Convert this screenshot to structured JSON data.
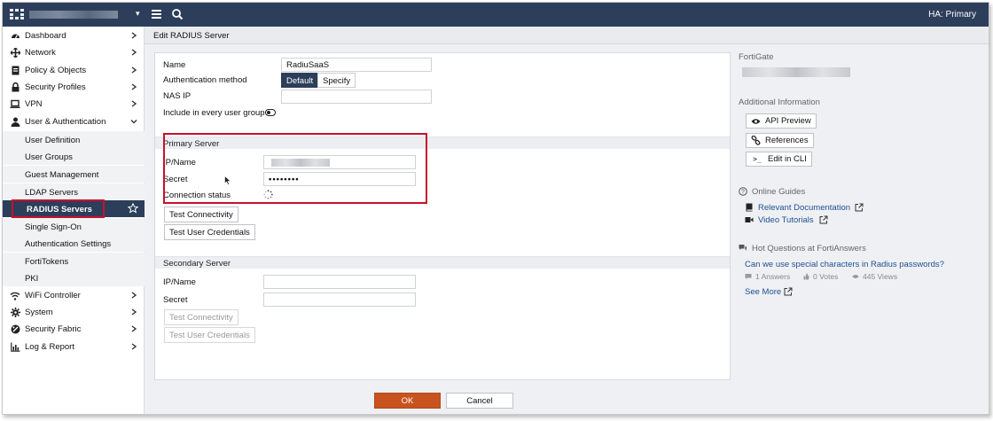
{
  "topbar": {
    "ha_status": "HA: Primary"
  },
  "sidebar": {
    "items": [
      {
        "label": "Dashboard",
        "icon": "dashboard-icon"
      },
      {
        "label": "Network",
        "icon": "network-icon"
      },
      {
        "label": "Policy & Objects",
        "icon": "policy-icon"
      },
      {
        "label": "Security Profiles",
        "icon": "lock-icon"
      },
      {
        "label": "VPN",
        "icon": "laptop-icon"
      },
      {
        "label": "User & Authentication",
        "icon": "user-icon"
      }
    ],
    "sub_items": [
      {
        "label": "User Definition"
      },
      {
        "label": "User Groups"
      },
      {
        "label": "Guest Management"
      },
      {
        "label": "LDAP Servers"
      },
      {
        "label": "RADIUS Servers"
      },
      {
        "label": "Single Sign-On"
      },
      {
        "label": "Authentication Settings"
      },
      {
        "label": "FortiTokens"
      },
      {
        "label": "PKI"
      }
    ],
    "items_bottom": [
      {
        "label": "WiFi Controller",
        "icon": "wifi-icon"
      },
      {
        "label": "System",
        "icon": "gear-icon"
      },
      {
        "label": "Security Fabric",
        "icon": "fabric-icon"
      },
      {
        "label": "Log & Report",
        "icon": "chart-icon"
      }
    ]
  },
  "page": {
    "title": "Edit RADIUS Server"
  },
  "form": {
    "name_label": "Name",
    "name_value": "RadiuSaaS",
    "auth_method_label": "Authentication method",
    "auth_default": "Default",
    "auth_specify": "Specify",
    "nas_ip_label": "NAS IP",
    "include_label": "Include in every user group",
    "primary": {
      "title": "Primary Server",
      "ip_label": "IP/Name",
      "secret_label": "Secret",
      "secret_value": "••••••••",
      "conn_status_label": "Connection status",
      "test_connectivity": "Test Connectivity",
      "test_user_credentials": "Test User Credentials"
    },
    "secondary": {
      "title": "Secondary Server",
      "ip_label": "IP/Name",
      "secret_label": "Secret",
      "test_connectivity": "Test Connectivity",
      "test_user_credentials": "Test User Credentials"
    },
    "ok": "OK",
    "cancel": "Cancel"
  },
  "right_panel": {
    "fortigate_title": "FortiGate",
    "additional_info_title": "Additional Information",
    "api_preview": "API Preview",
    "references": "References",
    "edit_in_cli": "Edit in CLI",
    "online_guides_title": "Online Guides",
    "relevant_documentation": "Relevant Documentation",
    "video_tutorials": "Video Tutorials",
    "hot_questions_title": "Hot Questions at FortiAnswers",
    "question": "Can we use special characters in Radius passwords?",
    "answers": "1 Answers",
    "votes": "0 Votes",
    "views": "445 Views",
    "see_more": "See More"
  }
}
